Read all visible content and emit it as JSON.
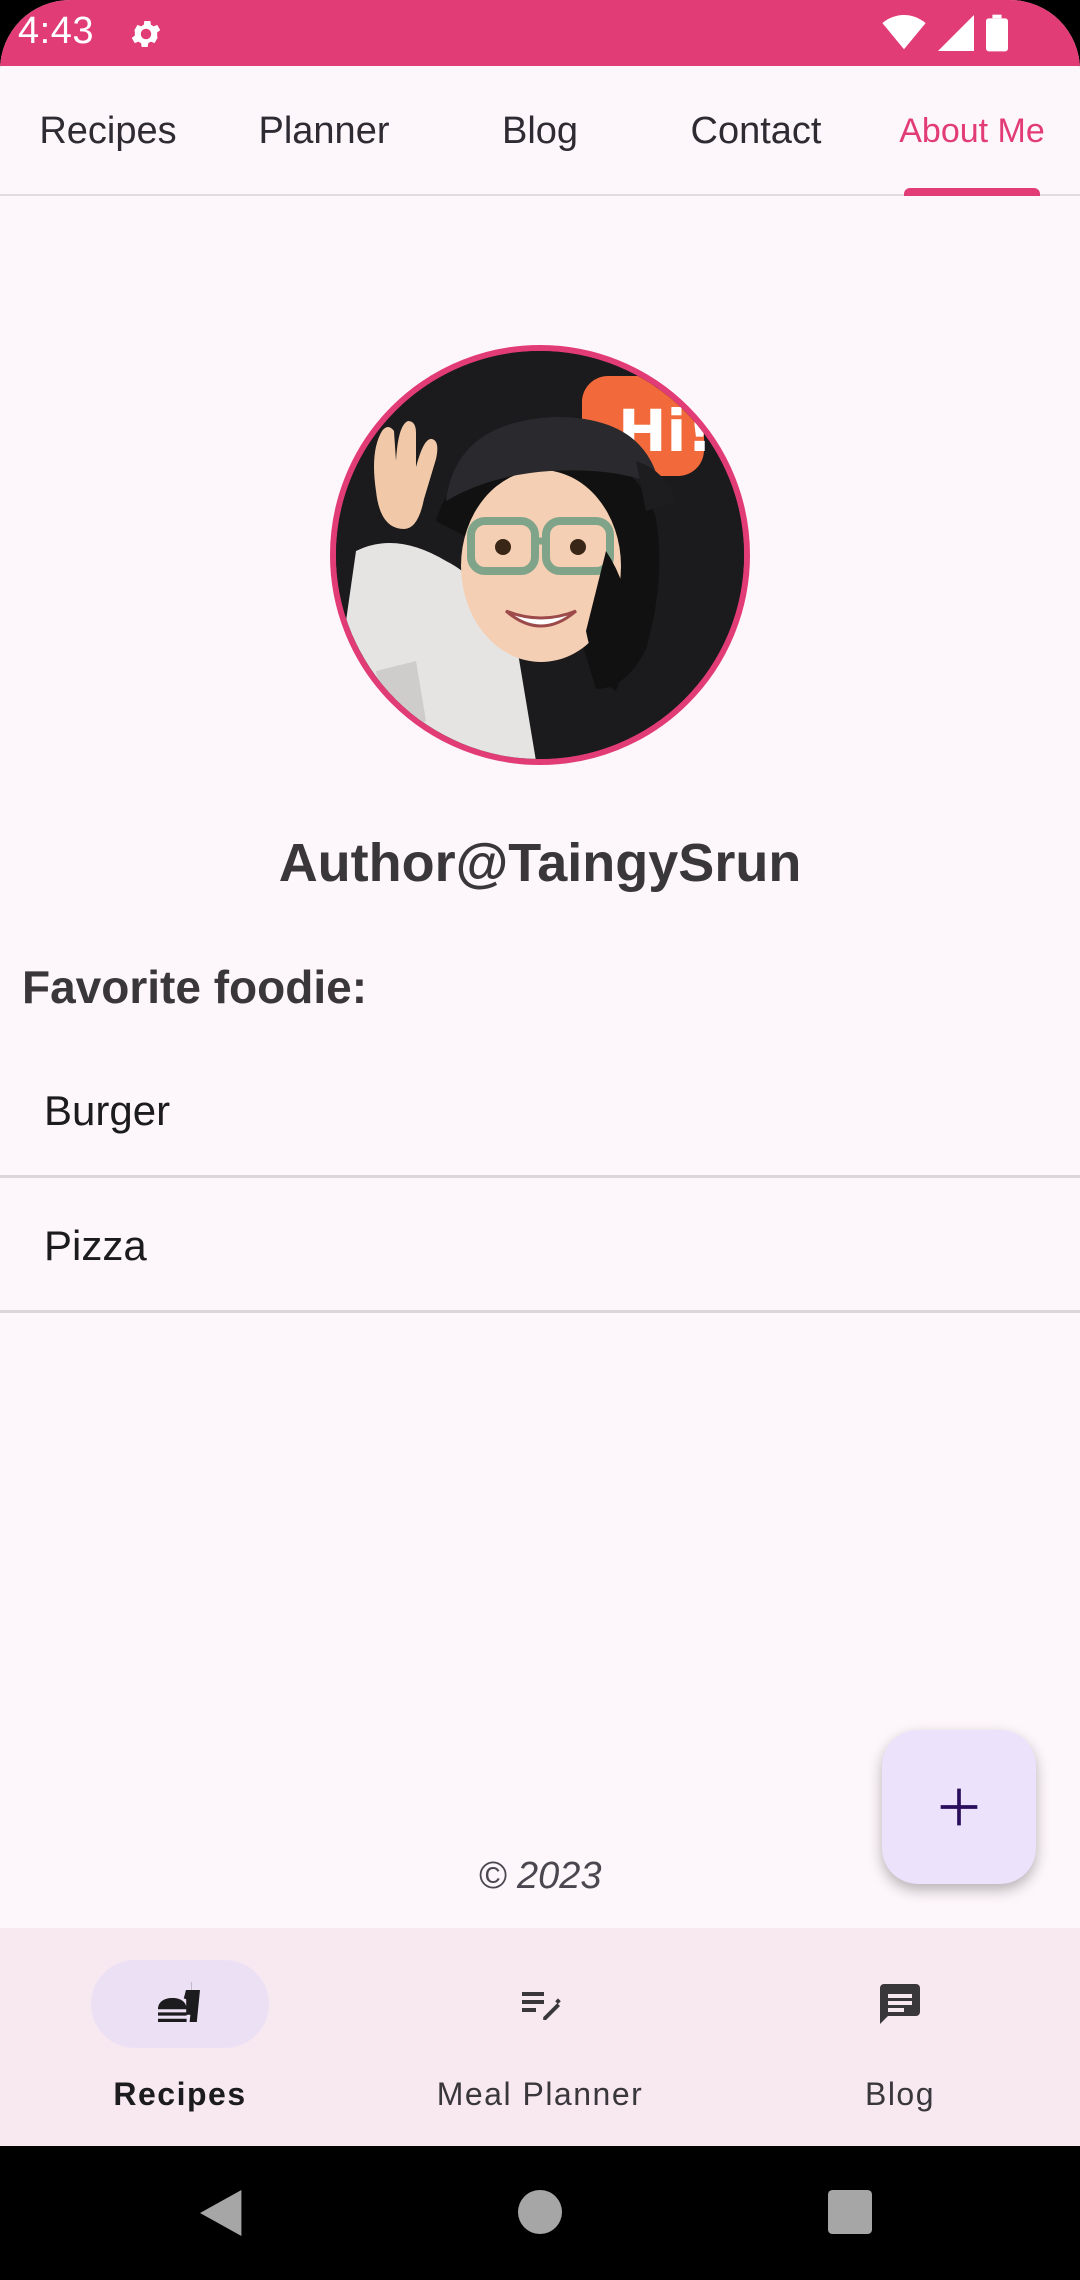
{
  "status_bar": {
    "time": "4:43",
    "icons": [
      "settings-icon",
      "wifi-icon",
      "cellular-icon",
      "battery-icon"
    ]
  },
  "tabs": [
    {
      "label": "Recipes",
      "active": false
    },
    {
      "label": "Planner",
      "active": false
    },
    {
      "label": "Blog",
      "active": false
    },
    {
      "label": "Contact",
      "active": false
    },
    {
      "label": "About Me",
      "active": true
    }
  ],
  "profile": {
    "avatar_icon": "avatar-hi-sticker",
    "author": "Author@TaingySrun",
    "favorite_title": "Favorite foodie:",
    "favorites": [
      "Burger",
      "Pizza"
    ]
  },
  "footer": {
    "copyright": "© 2023"
  },
  "fab": {
    "icon": "plus-icon"
  },
  "bottom_nav": [
    {
      "label": "Recipes",
      "icon": "fastfood-icon",
      "active": true
    },
    {
      "label": "Meal Planner",
      "icon": "edit-note-icon",
      "active": false
    },
    {
      "label": "Blog",
      "icon": "chat-icon",
      "active": false
    }
  ],
  "colors": {
    "primary": "#e23c76",
    "background": "#fdf6fa",
    "nav_background": "#f8e9f1",
    "fab_background": "#ece2fb",
    "fab_icon": "#2a0e5c"
  }
}
